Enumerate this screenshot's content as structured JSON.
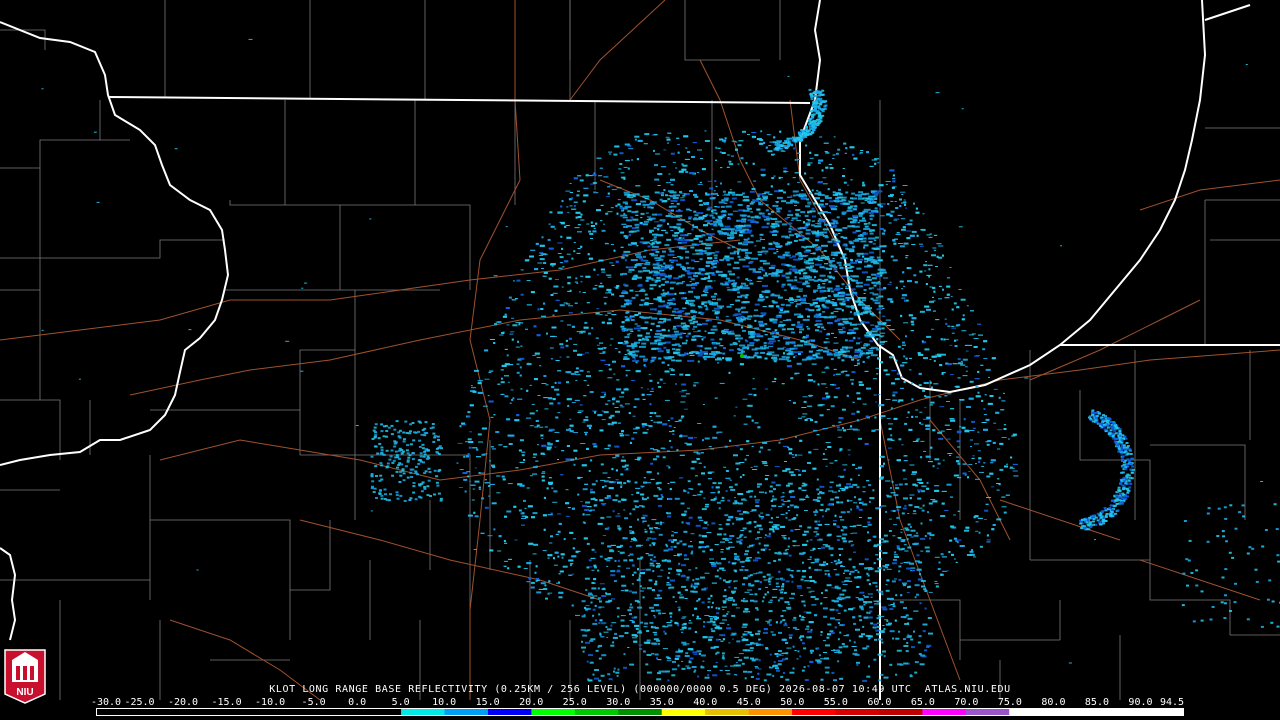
{
  "caption": {
    "station": "KLOT",
    "product": "LONG RANGE BASE REFLECTIVITY",
    "resolution": "(0.25KM / 256 LEVEL)",
    "code": "(000000/0000",
    "tilt": "0.5 DEG)",
    "datetime": "2026-08-07 10:49 UTC",
    "source": "ATLAS.NIU.EDU"
  },
  "scale": {
    "labels": [
      "-30.0",
      "-25.0",
      "-20.0",
      "-15.0",
      "-10.0",
      "-5.0",
      "0.0",
      "5.0",
      "10.0",
      "15.0",
      "20.0",
      "25.0",
      "30.0",
      "35.0",
      "40.0",
      "45.0",
      "50.0",
      "55.0",
      "60.0",
      "65.0",
      "70.0",
      "75.0",
      "80.0",
      "85.0",
      "90.0",
      "94.5"
    ],
    "colors": [
      "#000000",
      "#000000",
      "#000000",
      "#000000",
      "#000000",
      "#000000",
      "#000000",
      "#00e8e8",
      "#009ff5",
      "#0000f6",
      "#00ff00",
      "#00c800",
      "#009000",
      "#ffff00",
      "#e7c000",
      "#ff9000",
      "#ff0000",
      "#d60000",
      "#c00000",
      "#ff00ff",
      "#9955c9",
      "#ffffff",
      "#ffffff",
      "#ffffff",
      "#ffffff"
    ]
  },
  "logo": {
    "text": "NIU"
  },
  "colors": {
    "echo_light": "#22c8ec",
    "echo_mid": "#1aa8e8",
    "echo_dark": "#1060e0",
    "state_line": "#ffffff",
    "county_line": "#7a7a7a",
    "road_line": "#a0522d"
  }
}
